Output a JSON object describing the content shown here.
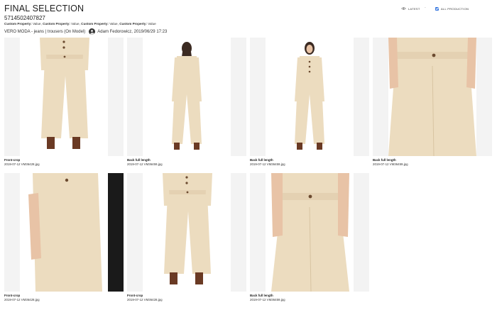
{
  "header": {
    "title": "FINAL SELECTION",
    "sku": "5714502407827",
    "properties": [
      {
        "name": "Custom Property:",
        "value": "Value"
      },
      {
        "name": "Custom Property:",
        "value": "Value"
      },
      {
        "name": "Custom Property:",
        "value": "Value"
      },
      {
        "name": "Custom Property:",
        "value": "Value"
      }
    ],
    "category": "VERO MODA - jeans | trousers (On Model)",
    "author": "Adam Fedorowicz, 2019/06/29 17:23"
  },
  "controls": {
    "latest_label": "LATEST",
    "separator": "-",
    "all_production_label": "ALL PRODUCTION",
    "all_production_checked": true
  },
  "colors": {
    "checkbox": "#3d7be0",
    "garment": "#ecdcbf",
    "photo_background": "#f3f3f3",
    "backdrop": "#ffffff"
  },
  "images": [
    {
      "caption": "Front-crop",
      "file": "2019-07-12 VM36428.jpg",
      "view": "front-crop"
    },
    {
      "caption": "Back full length",
      "file": "2019-07-12 VM36459.jpg",
      "view": "back-full"
    },
    {
      "caption": "Back full length",
      "file": "2019-07-12 VM36459.jpg",
      "view": "front-full"
    },
    {
      "caption": "Back full length",
      "file": "2019-07-12 VM36459.jpg",
      "view": "detail-waist"
    },
    {
      "caption": "Front-crop",
      "file": "2019-07-12 VM36428.jpg",
      "view": "side-detail"
    },
    {
      "caption": "Front-crop",
      "file": "2019-07-12 VM36428.jpg",
      "view": "front-crop"
    },
    {
      "caption": "Back full length",
      "file": "2019-07-12 VM36459.jpg",
      "view": "detail-front"
    }
  ]
}
